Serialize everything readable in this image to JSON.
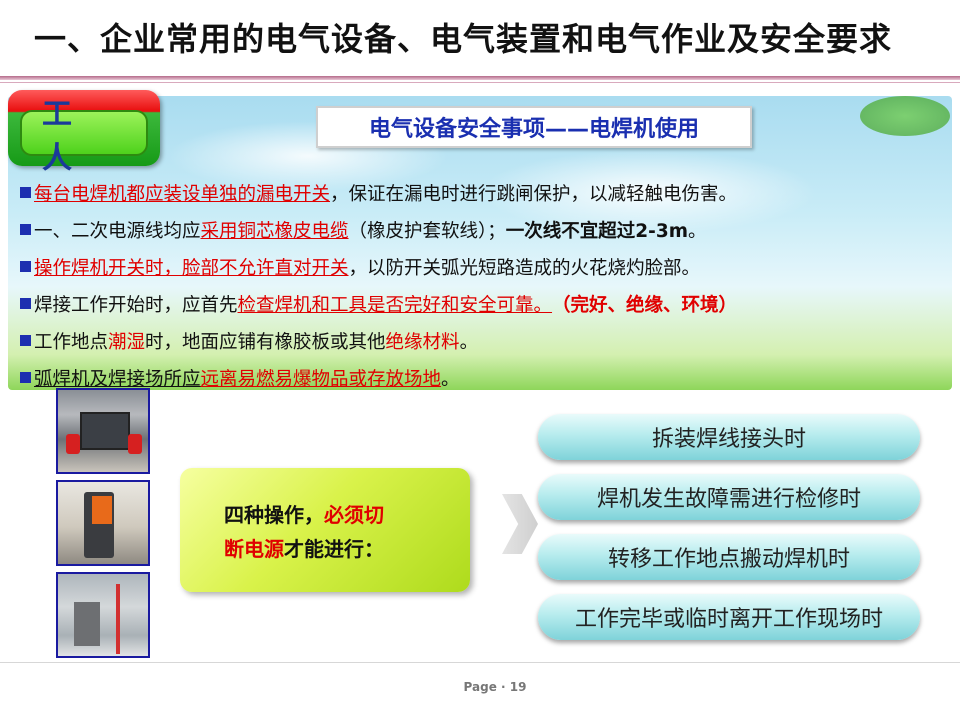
{
  "header": {
    "title": "一、企业常用的电气设备、电气装置和电气作业及安全要求"
  },
  "badge": {
    "label": "工 人"
  },
  "subtitle": "电气设备安全事项——电焊机使用",
  "bullets": [
    {
      "parts": [
        {
          "text": "每台电焊机都应装设单独的漏电开关",
          "style": "red-ul"
        },
        {
          "text": "，保证在漏电时进行跳闸保护，以减轻触电伤害。",
          "style": "normal"
        }
      ]
    },
    {
      "parts": [
        {
          "text": "一、二次电源线均应",
          "style": "normal"
        },
        {
          "text": "采用铜芯橡皮电缆",
          "style": "red-ul"
        },
        {
          "text": "（橡皮护套软线）；",
          "style": "normal"
        },
        {
          "text": "一次线不宜超过2-3m",
          "style": "bold"
        },
        {
          "text": "。",
          "style": "normal"
        }
      ]
    },
    {
      "parts": [
        {
          "text": "操作焊机开关时，脸部不允许直对开关",
          "style": "red-ul"
        },
        {
          "text": "，以防开关弧光短路造成的火花烧灼脸部。",
          "style": "normal"
        }
      ]
    },
    {
      "parts": [
        {
          "text": "焊接工作开始时，应首先",
          "style": "normal"
        },
        {
          "text": "检查焊机和工具是否完好和安全可靠。",
          "style": "red-ul"
        },
        {
          "text": "（完好、绝缘、环境）",
          "style": "red-bold"
        }
      ]
    },
    {
      "parts": [
        {
          "text": "工作地点",
          "style": "normal"
        },
        {
          "text": "潮湿",
          "style": "red"
        },
        {
          "text": "时，地面应铺有橡胶板或其他",
          "style": "normal"
        },
        {
          "text": "绝缘材料",
          "style": "red"
        },
        {
          "text": "。",
          "style": "normal"
        }
      ]
    },
    {
      "parts": [
        {
          "text": "弧焊机及焊接场所应",
          "style": "ul"
        },
        {
          "text": "远离易燃易爆物品或存放场地",
          "style": "red-ul"
        },
        {
          "text": "。",
          "style": "normal"
        }
      ]
    }
  ],
  "callout": {
    "line1_prefix": "四种操作，",
    "line1_red": "必须切",
    "line2_red": "断电源",
    "line2_suffix": "才能进行："
  },
  "operations": [
    "拆装焊线接头时",
    "焊机发生故障需进行检修时",
    "转移工作地点搬动焊机时",
    "工作完毕或临时离开工作现场时"
  ],
  "footer": {
    "page": "Page · 19"
  }
}
